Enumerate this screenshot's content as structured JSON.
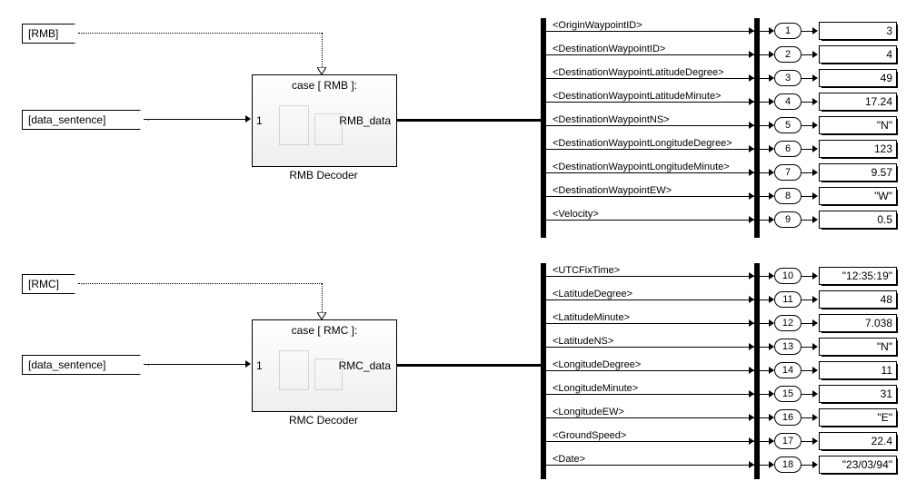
{
  "tags": {
    "rmb": "[RMB]",
    "rmc": "[RMC]",
    "data_sentence": "[data_sentence]"
  },
  "decoders": {
    "rmb": {
      "case": "case [ RMB ]:",
      "inport": "1",
      "outport": "RMB_data",
      "name": "RMB Decoder"
    },
    "rmc": {
      "case": "case [ RMC ]:",
      "inport": "1",
      "outport": "RMC_data",
      "name": "RMC Decoder"
    }
  },
  "rmb_signals": [
    {
      "label": "<OriginWaypointID>",
      "port": "1",
      "value": "3"
    },
    {
      "label": "<DestinationWaypointID>",
      "port": "2",
      "value": "4"
    },
    {
      "label": "<DestinationWaypointLatitudeDegree>",
      "port": "3",
      "value": "49"
    },
    {
      "label": "<DestinationWaypointLatitudeMinute>",
      "port": "4",
      "value": "17.24"
    },
    {
      "label": "<DestinationWaypointNS>",
      "port": "5",
      "value": "\"N\""
    },
    {
      "label": "<DestinationWaypointLongitudeDegree>",
      "port": "6",
      "value": "123"
    },
    {
      "label": "<DestinationWaypointLongitudeMinute>",
      "port": "7",
      "value": "9.57"
    },
    {
      "label": "<DestinationWaypointEW>",
      "port": "8",
      "value": "\"W\""
    },
    {
      "label": "<Velocity>",
      "port": "9",
      "value": "0.5"
    }
  ],
  "rmc_signals": [
    {
      "label": "<UTCFixTime>",
      "port": "10",
      "value": "\"12:35:19\""
    },
    {
      "label": "<LatitudeDegree>",
      "port": "11",
      "value": "48"
    },
    {
      "label": "<LatitudeMinute>",
      "port": "12",
      "value": "7.038"
    },
    {
      "label": "<LatitudeNS>",
      "port": "13",
      "value": "\"N\""
    },
    {
      "label": "<LongitudeDegree>",
      "port": "14",
      "value": "11"
    },
    {
      "label": "<LongitudeMinute>",
      "port": "15",
      "value": "31"
    },
    {
      "label": "<LongitudeEW>",
      "port": "16",
      "value": "\"E\""
    },
    {
      "label": "<GroundSpeed>",
      "port": "17",
      "value": "22.4"
    },
    {
      "label": "<Date>",
      "port": "18",
      "value": "\"23/03/94\""
    }
  ]
}
